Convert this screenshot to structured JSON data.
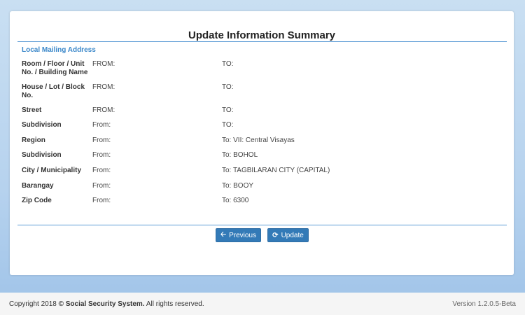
{
  "page": {
    "title": "Update Information Summary",
    "section_label": "Local Mailing Address"
  },
  "rows": [
    {
      "label": "Room / Floor / Unit No. / Building Name",
      "from": "FROM:",
      "to": "TO:"
    },
    {
      "label": "House / Lot / Block No.",
      "from": "FROM:",
      "to": "TO:"
    },
    {
      "label": "Street",
      "from": "FROM:",
      "to": "TO:"
    },
    {
      "label": "Subdivision",
      "from": "From:",
      "to": "TO:"
    },
    {
      "label": "Region",
      "from": "From:",
      "to": "To: VII: Central Visayas"
    },
    {
      "label": "Subdivision",
      "from": "From:",
      "to": "To: BOHOL"
    },
    {
      "label": "City / Municipality",
      "from": "From:",
      "to": "To: TAGBILARAN CITY (CAPITAL)"
    },
    {
      "label": "Barangay",
      "from": "From:",
      "to": "To: BOOY"
    },
    {
      "label": "Zip Code",
      "from": "From:",
      "to": "To: 6300"
    }
  ],
  "buttons": {
    "previous_label": "Previous",
    "previous_icon": "arrow-left-icon",
    "update_label": "Update",
    "update_icon": "refresh-icon"
  },
  "footer": {
    "copyright_prefix": "Copyright 2018",
    "copyright_symbol": "©",
    "copyright_org": "Social Security System.",
    "copyright_suffix": "All rights reserved.",
    "version": "Version 1.2.0.5-Beta"
  },
  "colors": {
    "accent": "#337ab7",
    "section_label": "#3a87c9",
    "rule": "#5b9bd5"
  }
}
